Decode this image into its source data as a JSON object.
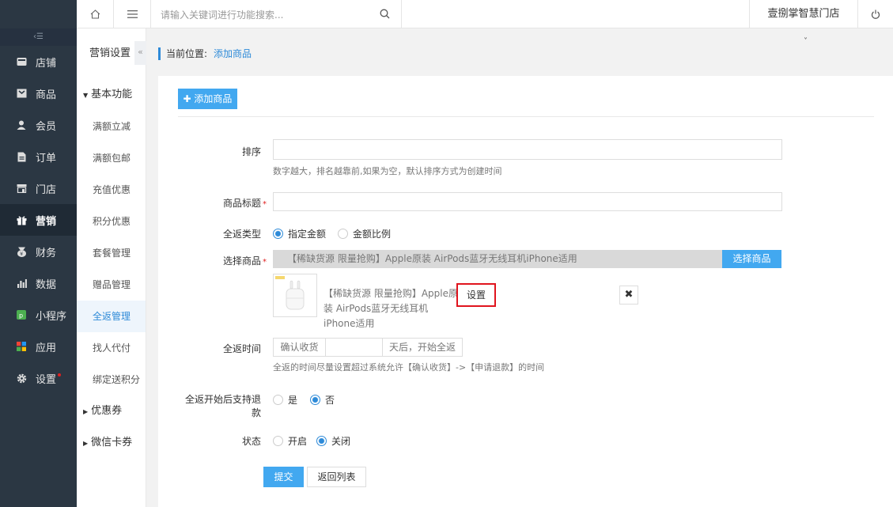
{
  "topbar": {
    "search_placeholder": "请输入关键词进行功能搜索...",
    "store_name": "壹捌掌智慧门店"
  },
  "sidebar": {
    "items": [
      {
        "label": "店铺",
        "icon": "store-icon"
      },
      {
        "label": "商品",
        "icon": "goods-icon"
      },
      {
        "label": "会员",
        "icon": "member-icon"
      },
      {
        "label": "订单",
        "icon": "order-icon"
      },
      {
        "label": "门店",
        "icon": "shop-icon"
      },
      {
        "label": "营销",
        "icon": "gift-icon",
        "active": true
      },
      {
        "label": "财务",
        "icon": "finance-icon"
      },
      {
        "label": "数据",
        "icon": "chart-icon"
      },
      {
        "label": "小程序",
        "icon": "miniapp-icon"
      },
      {
        "label": "应用",
        "icon": "apps-icon"
      },
      {
        "label": "设置",
        "icon": "gear-icon"
      }
    ]
  },
  "subnav": {
    "title": "营销设置",
    "group_basic": "基本功能",
    "items": [
      "满额立减",
      "满额包邮",
      "充值优惠",
      "积分优惠",
      "套餐管理",
      "赠品管理",
      "全返管理",
      "找人代付",
      "绑定送积分"
    ],
    "group_coupon": "优惠券",
    "group_wechat": "微信卡券"
  },
  "breadcrumb": {
    "prefix": "当前位置:",
    "current": "添加商品"
  },
  "form": {
    "add_button": "添加商品",
    "sort_label": "排序",
    "sort_help": "数字越大，排名越靠前,如果为空，默认排序方式为创建时间",
    "title_label": "商品标题",
    "type_label": "全返类型",
    "type_opt1": "指定金额",
    "type_opt2": "金额比例",
    "goods_label": "选择商品",
    "goods_selected": "【稀缺货源 限量抢购】Apple原装 AirPods蓝牙无线耳机iPhone适用",
    "select_goods_button": "选择商品",
    "goods_item_name": "【稀缺货源 限量抢购】Apple原装 AirPods蓝牙无线耳机iPhone适用",
    "set_button": "设置",
    "remove_symbol": "✖",
    "time_label": "全返时间",
    "time_prefix": "确认收货",
    "time_suffix": "天后，开始全返",
    "time_help": "全返的时间尽量设置超过系统允许【确认收货】->【申请退款】的时间",
    "refund_label": "全返开始后支持退款",
    "refund_yes": "是",
    "refund_no": "否",
    "status_label": "状态",
    "status_on": "开启",
    "status_off": "关闭",
    "submit_button": "提交",
    "back_button": "返回列表"
  },
  "colors": {
    "accent": "#42a8f0",
    "link": "#2d8ad8",
    "sidebar_bg": "#2b3743",
    "highlight_border": "#e0141e"
  }
}
